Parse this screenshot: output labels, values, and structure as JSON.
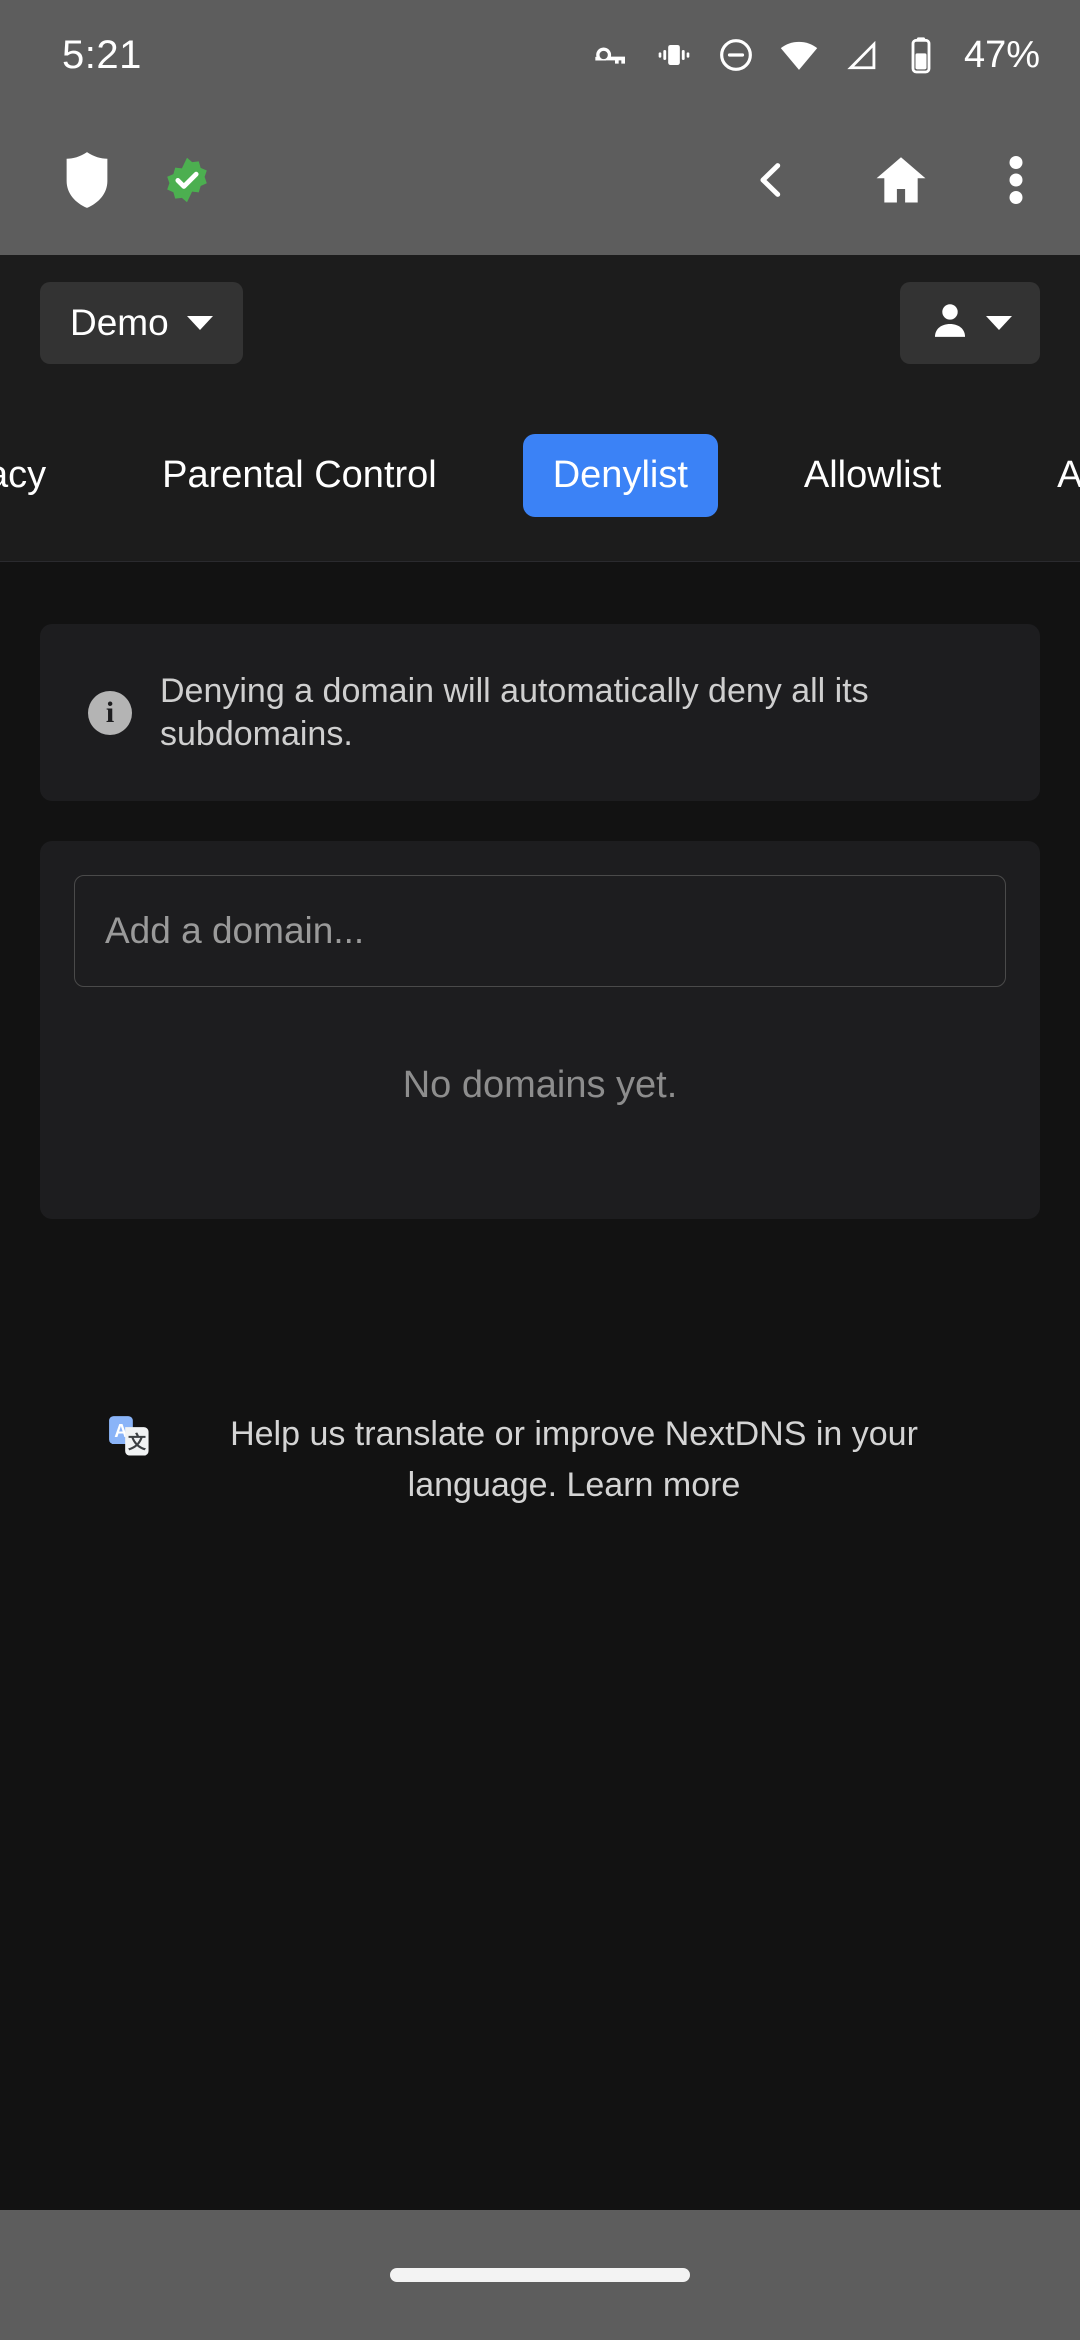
{
  "status_bar": {
    "time": "5:21",
    "battery_percent": "47%",
    "icons": [
      "vpn-key-icon",
      "vibrate-icon",
      "do-not-disturb-icon",
      "wifi-icon",
      "cell-signal-icon",
      "battery-icon"
    ]
  },
  "app_chrome": {
    "shield_icon": "shield-icon",
    "verified_icon": "verified-badge-icon",
    "back_icon": "back-chevron-icon",
    "home_icon": "home-icon",
    "overflow_icon": "more-vertical-icon"
  },
  "header": {
    "profile_name": "Demo",
    "profile_caret": "chevron-down-icon",
    "account_icon": "person-icon",
    "account_caret": "chevron-down-icon"
  },
  "tabs": [
    {
      "label": "vacy",
      "active": false,
      "truncated": true
    },
    {
      "label": "Parental Control",
      "active": false
    },
    {
      "label": "Denylist",
      "active": true
    },
    {
      "label": "Allowlist",
      "active": false
    },
    {
      "label": "Analytics",
      "active": false
    }
  ],
  "banner": {
    "icon": "info-icon",
    "icon_glyph": "i",
    "text": "Denying a domain will automatically deny all its subdomains."
  },
  "denylist": {
    "input_placeholder": "Add a domain...",
    "input_value": "",
    "empty_state": "No domains yet.",
    "domains": []
  },
  "footer": {
    "icon": "translate-icon",
    "text": "Help us translate or improve NextDNS in your language. Learn more"
  },
  "colors": {
    "accent": "#3b82f6",
    "system_chrome": "#5d5d5d",
    "page_bg": "#121212",
    "card_bg": "#1d1d1f",
    "header_bg": "#1c1c1c",
    "verified_green": "#4caf50"
  }
}
